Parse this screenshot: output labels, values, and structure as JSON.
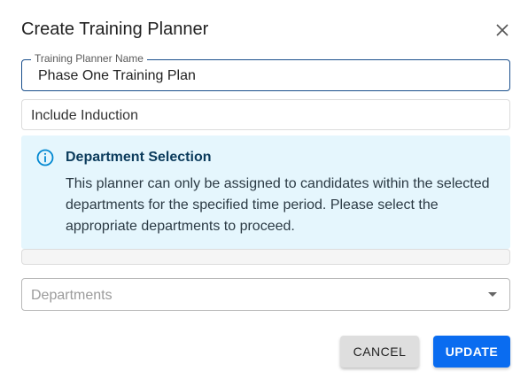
{
  "dialog": {
    "title": "Create Training Planner",
    "close_icon": "close-icon"
  },
  "fields": {
    "name_label": "Training Planner Name",
    "name_value": "Phase One Training Plan",
    "induction_value": "Include Induction"
  },
  "alert": {
    "icon": "info-icon",
    "title": "Department Selection",
    "body": "This planner can only be assigned to candidates within the selected departments for the specified time period. Please select the appropriate departments to proceed."
  },
  "departments": {
    "placeholder": "Departments",
    "caret_icon": "caret-down-icon"
  },
  "actions": {
    "cancel_label": "CANCEL",
    "update_label": "UPDATE"
  },
  "colors": {
    "primary": "#0a6cf0",
    "alert_background": "#e5f6fd",
    "alert_icon": "#0288d1",
    "focused_border": "#1a4f8c"
  }
}
